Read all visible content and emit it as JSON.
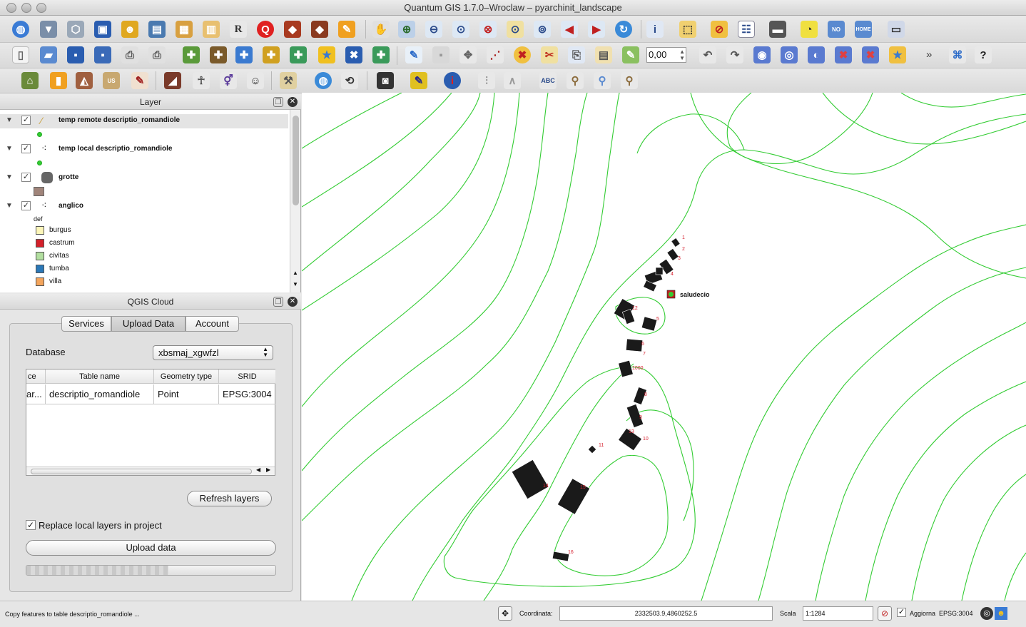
{
  "window": {
    "title": "Quantum GIS 1.7.0–Wroclaw – pyarchinit_landscape"
  },
  "toolbar": {
    "scale_value": "0,00",
    "overflow": "»"
  },
  "layer_panel": {
    "title": "Layer",
    "layers": [
      {
        "name": "temp remote descriptio_romandiole",
        "checked": "✓"
      },
      {
        "name": "temp local descriptio_romandiole",
        "checked": "✓"
      },
      {
        "name": "grotte",
        "checked": "✓"
      },
      {
        "name": "anglico",
        "checked": "✓"
      }
    ],
    "category_field": "def",
    "categories": [
      {
        "label": "burgus",
        "color": "#fdf6b9"
      },
      {
        "label": "castrum",
        "color": "#d4202a"
      },
      {
        "label": "civitas",
        "color": "#b2dfa0"
      },
      {
        "label": "tumba",
        "color": "#2a78b8"
      },
      {
        "label": "villa",
        "color": "#f4a55c"
      }
    ]
  },
  "cloud_panel": {
    "title": "QGIS Cloud",
    "tabs": [
      "Services",
      "Upload Data",
      "Account"
    ],
    "database_label": "Database",
    "database_value": "xbsmaj_xgwfzl",
    "table": {
      "headers": [
        "ce",
        "Table name",
        "Geometry type",
        "SRID"
      ],
      "rows": [
        [
          "ar...",
          "descriptio_romandiole",
          "Point",
          "EPSG:3004"
        ]
      ]
    },
    "refresh_button": "Refresh layers",
    "replace_checkbox": {
      "label": "Replace local layers in project",
      "checked": "✓"
    },
    "upload_button": "Upload data",
    "progress": 0.57
  },
  "map": {
    "place_label": "saludecio",
    "feature_labels": [
      "1",
      "2",
      "3",
      "4",
      "5",
      "6",
      "7",
      "8",
      "9",
      "10",
      "11",
      "12",
      "13",
      "14",
      "15",
      "16",
      "1000"
    ]
  },
  "status": {
    "message": "Copy features to table descriptio_romandiole ...",
    "coord_label": "Coordinata:",
    "coord_value": "2332503.9,4860252.5",
    "scale_label": "Scala",
    "scale_value": "1:1284",
    "render_label": "Aggiorna",
    "render_checked": "✓",
    "crs": "EPSG:3004"
  },
  "colors": {
    "contour": "#33cc33",
    "label_red": "#d62230",
    "accent_blue": "#3a7bd5"
  }
}
